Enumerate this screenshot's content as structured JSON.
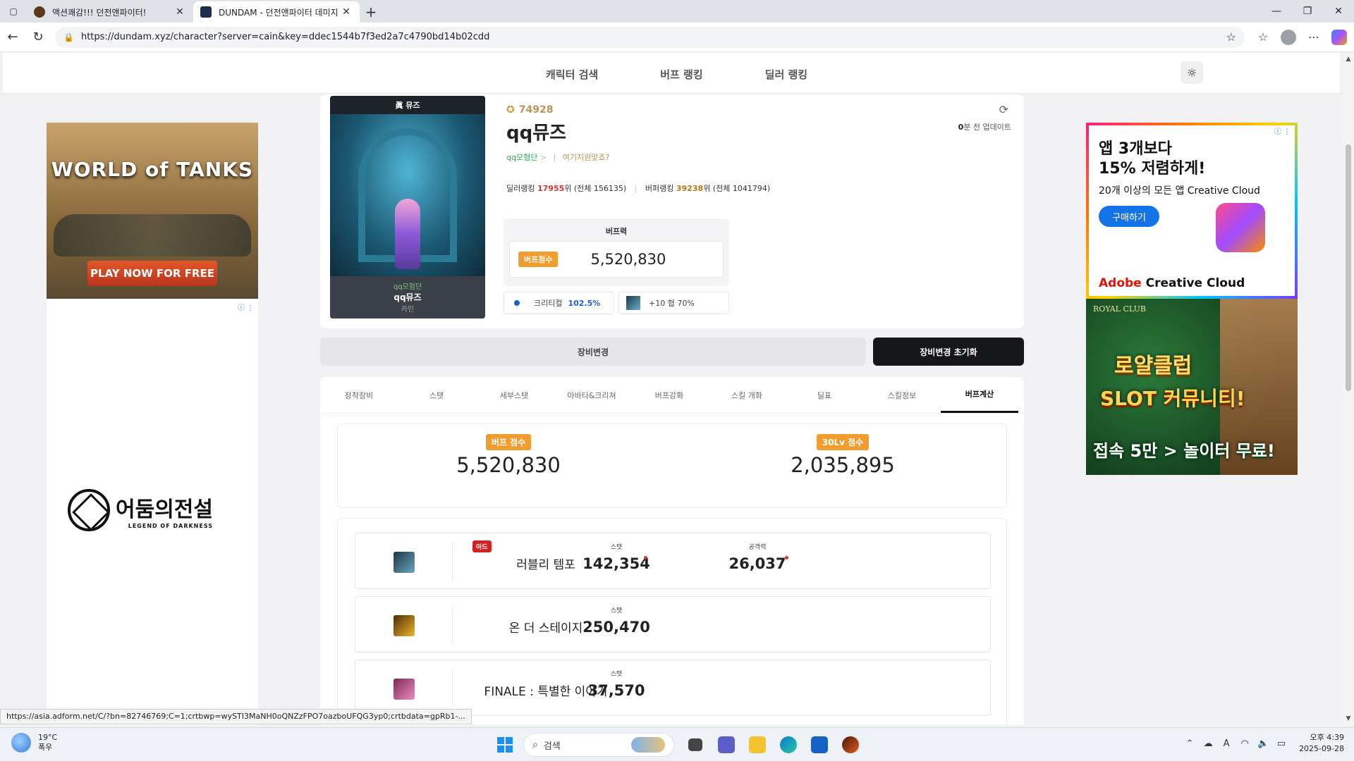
{
  "browser": {
    "tabs": [
      {
        "title": "액션쾌감!!! 던전앤파이터!",
        "active": false,
        "favicon_color": "#5a3a1a"
      },
      {
        "title": "DUNDAM - 던전앤파이터 데미지",
        "active": true,
        "favicon_color": "#1d2d4a"
      }
    ],
    "url": "https://dundam.xyz/character?server=cain&key=ddec1544b7f3ed2a7c4790bd14b02cdd"
  },
  "site_nav": {
    "links": [
      "캐릭터 검색",
      "버프 랭킹",
      "딜러 랭킹"
    ],
    "theme_icon": "sun-icon"
  },
  "character": {
    "portrait_title": "眞 뮤즈",
    "portrait_guild": "qq모험단",
    "portrait_name": "qq뮤즈",
    "portrait_server": "카인",
    "fame": "74928",
    "name": "qq뮤즈",
    "adventure": "qq모험단",
    "adventure_arrow": ">",
    "location_link": "여기지원맞죠?",
    "dealer_rank_label": "딜러랭킹",
    "dealer_rank": "17955",
    "dealer_rank_suffix": "위 (전체 156135)",
    "buffer_rank_label": "버퍼랭킹",
    "buffer_rank": "39238",
    "buffer_rank_suffix": "위 (전체 1041794)",
    "updated_num": "0",
    "updated_text": "분 전 업데이트"
  },
  "buff_box": {
    "header": "버프력",
    "badge": "버프점수",
    "value": "5,520,830",
    "crit_label": "크리티컬",
    "crit_value": "102.5%",
    "item_label": "+10 협 70%"
  },
  "buttons": {
    "change": "장비변경",
    "reset": "장비변경 초기화"
  },
  "tabs": [
    "장착장비",
    "스탯",
    "세부스탯",
    "아바타&크리쳐",
    "버프강화",
    "스킬 개화",
    "딜표",
    "스킬정보",
    "버프계산"
  ],
  "active_tab": "버프계산",
  "scores": [
    {
      "label": "버프 점수",
      "value": "5,520,830"
    },
    {
      "label": "30Lv 점수",
      "value": "2,035,895"
    }
  ],
  "skills": [
    {
      "name": "러블리 템포",
      "tag": "아드",
      "stat_label": "스탯",
      "stat": "142,354",
      "atk_label": "공격력",
      "atk": "26,037",
      "icon_color": "#2a4b5e"
    },
    {
      "name": "온 더 스테이지",
      "tag": "",
      "stat_label": "스탯",
      "stat": "250,470",
      "atk_label": "",
      "atk": "",
      "icon_color": "#b8861c"
    },
    {
      "name": "FINALE : 특별한 이야기",
      "tag": "",
      "stat_label": "스탯",
      "stat": "37,570",
      "atk_label": "",
      "atk": "",
      "icon_color": "#c0457a"
    }
  ],
  "ads": {
    "left_top": {
      "logo": "WORLD of TANKS",
      "cta": "PLAY NOW FOR FREE"
    },
    "left_bottom": {
      "title": "어둠의전설",
      "sub": "LEGEND OF DARKNESS"
    },
    "right_top": {
      "headline1": "앱 3개보다",
      "headline2": "15% 저렴하게!",
      "sub": "20개 이상의 모든 앱 Creative Cloud",
      "button": "구매하기",
      "brand_a": "Adobe",
      "brand_b": " Creative Cloud"
    },
    "right_bottom": {
      "brand": "ROYAL CLUB",
      "line1": "로얄클럽",
      "line2": "SLOT 커뮤니티!",
      "line3": "접속 5만 > 놀이터 무료!"
    }
  },
  "status_url": "https://asia.adform.net/C/?bn=82746769;C=1;crtbwp=wySTI3MaNH0oQNZzFPO7oazboUFQG3yp0;crtbdata=gpRb1-...",
  "taskbar": {
    "temp": "19°C",
    "weather": "폭우",
    "search_placeholder": "검색",
    "time": "오후 4:39",
    "date": "2025-09-28"
  }
}
